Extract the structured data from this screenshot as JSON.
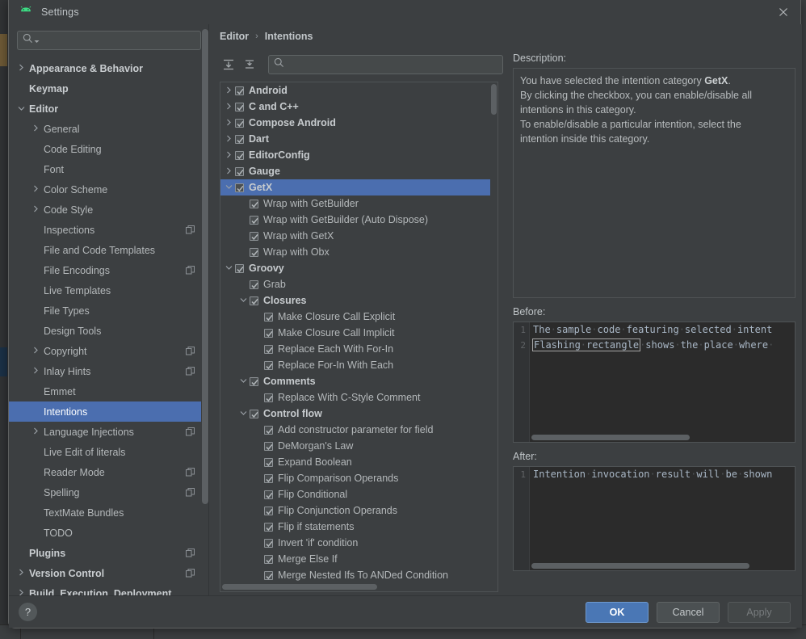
{
  "window": {
    "title": "Settings",
    "logo_icon": "android-logo-icon",
    "close_icon": "close-icon"
  },
  "sidebar": {
    "search": {
      "placeholder": "",
      "value": "",
      "icon": "search-icon",
      "caret_icon": "chevron-down-icon"
    },
    "items": [
      {
        "label": "Appearance & Behavior",
        "arrow": "collapsed",
        "indent": 0,
        "top": true,
        "copy": false,
        "selected": false
      },
      {
        "label": "Keymap",
        "arrow": "none",
        "indent": 0,
        "top": true,
        "copy": false,
        "selected": false
      },
      {
        "label": "Editor",
        "arrow": "expanded",
        "indent": 0,
        "top": true,
        "copy": false,
        "selected": false
      },
      {
        "label": "General",
        "arrow": "collapsed",
        "indent": 1,
        "top": false,
        "copy": false,
        "selected": false
      },
      {
        "label": "Code Editing",
        "arrow": "none",
        "indent": 1,
        "top": false,
        "copy": false,
        "selected": false
      },
      {
        "label": "Font",
        "arrow": "none",
        "indent": 1,
        "top": false,
        "copy": false,
        "selected": false
      },
      {
        "label": "Color Scheme",
        "arrow": "collapsed",
        "indent": 1,
        "top": false,
        "copy": false,
        "selected": false
      },
      {
        "label": "Code Style",
        "arrow": "collapsed",
        "indent": 1,
        "top": false,
        "copy": false,
        "selected": false
      },
      {
        "label": "Inspections",
        "arrow": "none",
        "indent": 1,
        "top": false,
        "copy": true,
        "selected": false
      },
      {
        "label": "File and Code Templates",
        "arrow": "none",
        "indent": 1,
        "top": false,
        "copy": false,
        "selected": false
      },
      {
        "label": "File Encodings",
        "arrow": "none",
        "indent": 1,
        "top": false,
        "copy": true,
        "selected": false
      },
      {
        "label": "Live Templates",
        "arrow": "none",
        "indent": 1,
        "top": false,
        "copy": false,
        "selected": false
      },
      {
        "label": "File Types",
        "arrow": "none",
        "indent": 1,
        "top": false,
        "copy": false,
        "selected": false
      },
      {
        "label": "Design Tools",
        "arrow": "none",
        "indent": 1,
        "top": false,
        "copy": false,
        "selected": false
      },
      {
        "label": "Copyright",
        "arrow": "collapsed",
        "indent": 1,
        "top": false,
        "copy": true,
        "selected": false
      },
      {
        "label": "Inlay Hints",
        "arrow": "collapsed",
        "indent": 1,
        "top": false,
        "copy": true,
        "selected": false
      },
      {
        "label": "Emmet",
        "arrow": "none",
        "indent": 1,
        "top": false,
        "copy": false,
        "selected": false
      },
      {
        "label": "Intentions",
        "arrow": "none",
        "indent": 1,
        "top": false,
        "copy": false,
        "selected": true
      },
      {
        "label": "Language Injections",
        "arrow": "collapsed",
        "indent": 1,
        "top": false,
        "copy": true,
        "selected": false
      },
      {
        "label": "Live Edit of literals",
        "arrow": "none",
        "indent": 1,
        "top": false,
        "copy": false,
        "selected": false
      },
      {
        "label": "Reader Mode",
        "arrow": "none",
        "indent": 1,
        "top": false,
        "copy": true,
        "selected": false
      },
      {
        "label": "Spelling",
        "arrow": "none",
        "indent": 1,
        "top": false,
        "copy": true,
        "selected": false
      },
      {
        "label": "TextMate Bundles",
        "arrow": "none",
        "indent": 1,
        "top": false,
        "copy": false,
        "selected": false
      },
      {
        "label": "TODO",
        "arrow": "none",
        "indent": 1,
        "top": false,
        "copy": false,
        "selected": false
      },
      {
        "label": "Plugins",
        "arrow": "none",
        "indent": 0,
        "top": true,
        "copy": true,
        "selected": false
      },
      {
        "label": "Version Control",
        "arrow": "collapsed",
        "indent": 0,
        "top": true,
        "copy": true,
        "selected": false
      },
      {
        "label": "Build, Execution, Deployment",
        "arrow": "collapsed",
        "indent": 0,
        "top": true,
        "copy": false,
        "selected": false
      }
    ]
  },
  "breadcrumb": {
    "parent": "Editor",
    "separator": "›",
    "current": "Intentions"
  },
  "tree_toolbar": {
    "expand_all_icon": "expand-all-icon",
    "collapse_all_icon": "collapse-all-icon",
    "search": {
      "placeholder": "",
      "value": "",
      "icon": "search-icon"
    }
  },
  "intentions_tree": [
    {
      "label": "Android",
      "arrow": "collapsed",
      "indent": 0,
      "checked": true,
      "bold": true,
      "selected": false
    },
    {
      "label": "C and C++",
      "arrow": "collapsed",
      "indent": 0,
      "checked": true,
      "bold": true,
      "selected": false
    },
    {
      "label": "Compose Android",
      "arrow": "collapsed",
      "indent": 0,
      "checked": true,
      "bold": true,
      "selected": false
    },
    {
      "label": "Dart",
      "arrow": "collapsed",
      "indent": 0,
      "checked": true,
      "bold": true,
      "selected": false
    },
    {
      "label": "EditorConfig",
      "arrow": "collapsed",
      "indent": 0,
      "checked": true,
      "bold": true,
      "selected": false
    },
    {
      "label": "Gauge",
      "arrow": "collapsed",
      "indent": 0,
      "checked": true,
      "bold": true,
      "selected": false
    },
    {
      "label": "GetX",
      "arrow": "expanded",
      "indent": 0,
      "checked": true,
      "bold": true,
      "selected": true
    },
    {
      "label": "Wrap with GetBuilder",
      "arrow": "none",
      "indent": 1,
      "checked": true,
      "bold": false,
      "selected": false
    },
    {
      "label": "Wrap with GetBuilder (Auto Dispose)",
      "arrow": "none",
      "indent": 1,
      "checked": true,
      "bold": false,
      "selected": false
    },
    {
      "label": "Wrap with GetX",
      "arrow": "none",
      "indent": 1,
      "checked": true,
      "bold": false,
      "selected": false
    },
    {
      "label": "Wrap with Obx",
      "arrow": "none",
      "indent": 1,
      "checked": true,
      "bold": false,
      "selected": false
    },
    {
      "label": "Groovy",
      "arrow": "expanded",
      "indent": 0,
      "checked": true,
      "bold": true,
      "selected": false
    },
    {
      "label": "Grab",
      "arrow": "none",
      "indent": 1,
      "checked": true,
      "bold": false,
      "selected": false
    },
    {
      "label": "Closures",
      "arrow": "expanded",
      "indent": 1,
      "checked": true,
      "bold": true,
      "selected": false
    },
    {
      "label": "Make Closure Call Explicit",
      "arrow": "none",
      "indent": 2,
      "checked": true,
      "bold": false,
      "selected": false
    },
    {
      "label": "Make Closure Call Implicit",
      "arrow": "none",
      "indent": 2,
      "checked": true,
      "bold": false,
      "selected": false
    },
    {
      "label": "Replace Each With For-In",
      "arrow": "none",
      "indent": 2,
      "checked": true,
      "bold": false,
      "selected": false
    },
    {
      "label": "Replace For-In With Each",
      "arrow": "none",
      "indent": 2,
      "checked": true,
      "bold": false,
      "selected": false
    },
    {
      "label": "Comments",
      "arrow": "expanded",
      "indent": 1,
      "checked": true,
      "bold": true,
      "selected": false
    },
    {
      "label": "Replace With C-Style Comment",
      "arrow": "none",
      "indent": 2,
      "checked": true,
      "bold": false,
      "selected": false
    },
    {
      "label": "Control flow",
      "arrow": "expanded",
      "indent": 1,
      "checked": true,
      "bold": true,
      "selected": false
    },
    {
      "label": "Add constructor parameter for field",
      "arrow": "none",
      "indent": 2,
      "checked": true,
      "bold": false,
      "selected": false
    },
    {
      "label": "DeMorgan's Law",
      "arrow": "none",
      "indent": 2,
      "checked": true,
      "bold": false,
      "selected": false
    },
    {
      "label": "Expand Boolean",
      "arrow": "none",
      "indent": 2,
      "checked": true,
      "bold": false,
      "selected": false
    },
    {
      "label": "Flip Comparison Operands",
      "arrow": "none",
      "indent": 2,
      "checked": true,
      "bold": false,
      "selected": false
    },
    {
      "label": "Flip Conditional",
      "arrow": "none",
      "indent": 2,
      "checked": true,
      "bold": false,
      "selected": false
    },
    {
      "label": "Flip Conjunction Operands",
      "arrow": "none",
      "indent": 2,
      "checked": true,
      "bold": false,
      "selected": false
    },
    {
      "label": "Flip if statements",
      "arrow": "none",
      "indent": 2,
      "checked": true,
      "bold": false,
      "selected": false
    },
    {
      "label": "Invert 'if' condition",
      "arrow": "none",
      "indent": 2,
      "checked": true,
      "bold": false,
      "selected": false
    },
    {
      "label": "Merge Else If",
      "arrow": "none",
      "indent": 2,
      "checked": true,
      "bold": false,
      "selected": false
    },
    {
      "label": "Merge Nested Ifs To ANDed Condition",
      "arrow": "none",
      "indent": 2,
      "checked": true,
      "bold": false,
      "selected": false
    }
  ],
  "description": {
    "label": "Description:",
    "line1_pre": "You have selected the intention category ",
    "line1_bold": "GetX",
    "line1_post": ".",
    "line2": "By clicking the checkbox, you can enable/disable all",
    "line3": "intentions in this category.",
    "line4": "To enable/disable a particular intention, select the",
    "line5": "intention inside this category."
  },
  "before": {
    "label": "Before:",
    "lines": [
      {
        "num": "1",
        "text": "The sample code featuring selected intent",
        "highlight": ""
      },
      {
        "num": "2",
        "text": "",
        "highlight": "Flashing rectangle",
        "after": " shows the place where "
      }
    ]
  },
  "after": {
    "label": "After:",
    "lines": [
      {
        "num": "1",
        "text": "Intention invocation result will be shown"
      }
    ]
  },
  "footer": {
    "help_label": "?",
    "ok_label": "OK",
    "cancel_label": "Cancel",
    "apply_label": "Apply",
    "apply_disabled": true
  },
  "colors": {
    "accent_selection": "#4b6eaf",
    "primary_button": "#4a77b5",
    "dialog_bg": "#3c3f41",
    "code_bg": "#2b2b2b",
    "android_green": "#3ddc84"
  }
}
